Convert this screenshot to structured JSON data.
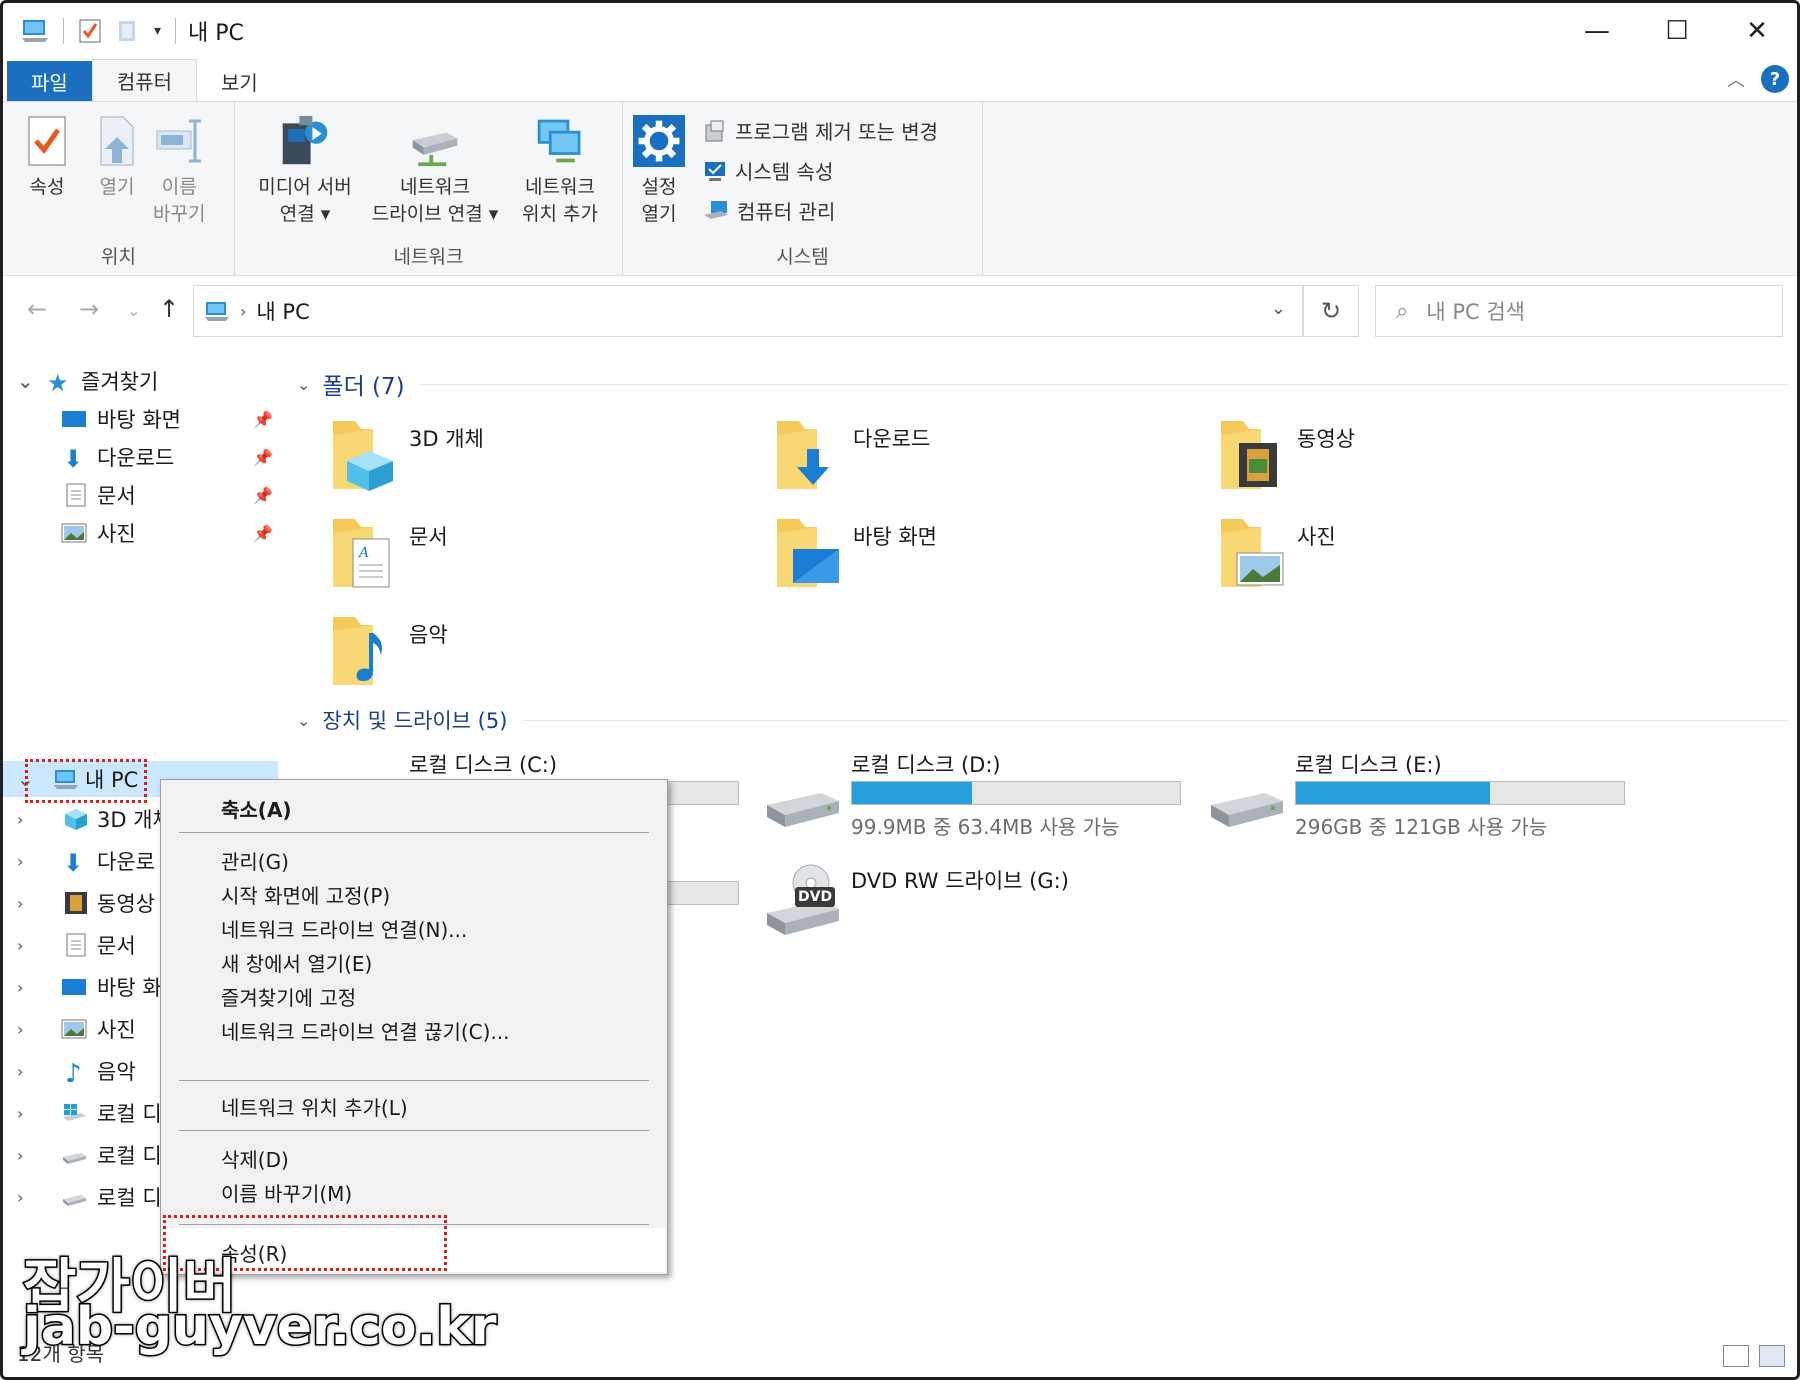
{
  "window": {
    "title": "내 PC",
    "minimize": "—",
    "maximize": "☐",
    "close": "✕"
  },
  "ribbon_tabs": [
    {
      "label": "파일"
    },
    {
      "label": "컴퓨터"
    },
    {
      "label": "보기"
    }
  ],
  "ribbon": {
    "location": {
      "label": "위치",
      "properties": "속성",
      "open": "열기",
      "rename_1": "이름",
      "rename_2": "바꾸기"
    },
    "network": {
      "label": "네트워크",
      "media_server_1": "미디어 서버",
      "media_server_2": "연결 ▾",
      "map_drive_1": "네트워크",
      "map_drive_2": "드라이브 연결 ▾",
      "add_location_1": "네트워크",
      "add_location_2": "위치 추가"
    },
    "system": {
      "label": "시스템",
      "settings_1": "설정",
      "settings_2": "열기",
      "uninstall": "프로그램 제거 또는 변경",
      "system_properties": "시스템 속성",
      "manage": "컴퓨터 관리"
    }
  },
  "address": {
    "crumb": "내 PC",
    "search_placeholder": "내 PC 검색"
  },
  "nav_pane": {
    "quick_access": "즐겨찾기",
    "quick_items": [
      "바탕 화면",
      "다운로드",
      "문서",
      "사진"
    ],
    "this_pc": "내 PC",
    "pc_items": [
      "3D 개체",
      "다운로",
      "동영상",
      "문서",
      "바탕 화",
      "사진",
      "음악",
      "로컬 디",
      "로컬 디",
      "로컬 디"
    ]
  },
  "folders_section": {
    "title": "폴더 (7)",
    "items": [
      "3D 개체",
      "다운로드",
      "동영상",
      "문서",
      "바탕 화면",
      "사진",
      "음악"
    ]
  },
  "drives_section": {
    "title": "장치 및 드라이브 (5)",
    "drives": [
      {
        "name": "로컬 디스크 (C:)"
      },
      {
        "name": "로컬 디스크 (D:)",
        "info": "99.9MB 중 63.4MB 사용 가능",
        "used_fraction": 0.365
      },
      {
        "name": "로컬 디스크 (E:)",
        "info": "296GB 중 121GB 사용 가능",
        "used_fraction": 0.59
      },
      {
        "name": "DVD RW 드라이브 (G:)",
        "badge": "DVD"
      }
    ]
  },
  "context_menu": {
    "items": [
      {
        "label": "축소(A)"
      },
      {
        "label": "관리(G)"
      },
      {
        "label": "시작 화면에 고정(P)"
      },
      {
        "label": "네트워크 드라이브 연결(N)..."
      },
      {
        "label": "새 창에서 열기(E)"
      },
      {
        "label": "즐겨찾기에 고정"
      },
      {
        "label": "네트워크 드라이브 연결 끊기(C)..."
      },
      {
        "label": "네트워크 위치 추가(L)"
      },
      {
        "label": "삭제(D)"
      },
      {
        "label": "이름 바꾸기(M)"
      },
      {
        "label": "속성(R)"
      }
    ]
  },
  "status_bar": {
    "count": "12개 항목"
  },
  "watermark": {
    "line1": "잡가이버",
    "line2": "jab-guyver.co.kr"
  },
  "colors": {
    "accent": "#1a6fc0",
    "progress": "#26a0da",
    "highlight": "#e11a1a",
    "selection": "#cce8ff"
  }
}
